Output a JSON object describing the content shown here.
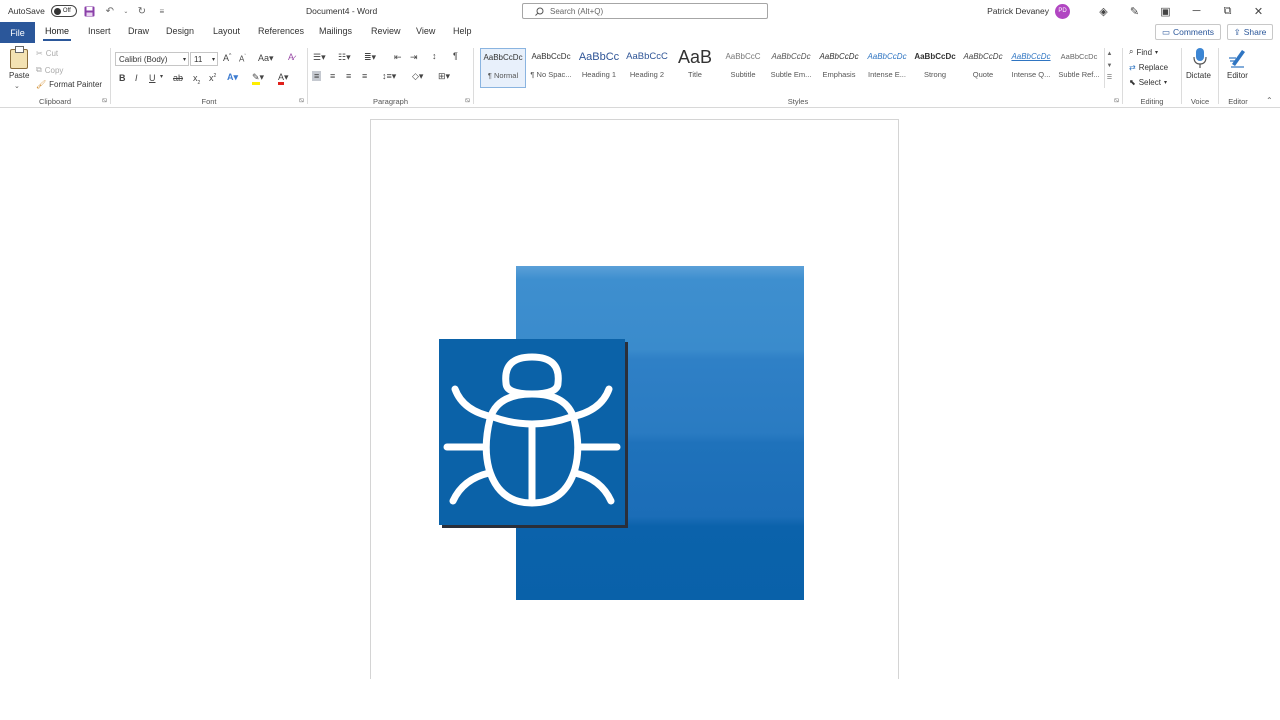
{
  "titlebar": {
    "autosave_label": "AutoSave",
    "autosave_state": "Off",
    "document_title": "Document4 - Word",
    "search_placeholder": "Search (Alt+Q)",
    "user_name": "Patrick Devaney",
    "user_initials": "PD"
  },
  "tabs": [
    "File",
    "Home",
    "Insert",
    "Draw",
    "Design",
    "Layout",
    "References",
    "Mailings",
    "Review",
    "View",
    "Help"
  ],
  "active_tab": "Home",
  "actions": {
    "comments_label": "Comments",
    "share_label": "Share"
  },
  "ribbon": {
    "clipboard": {
      "paste": "Paste",
      "cut": "Cut",
      "copy": "Copy",
      "format_painter": "Format Painter",
      "label": "Clipboard"
    },
    "font": {
      "font_name": "Calibri (Body)",
      "font_size": "11",
      "label": "Font"
    },
    "paragraph": {
      "label": "Paragraph"
    },
    "styles": {
      "label": "Styles",
      "items": [
        {
          "sample": "AaBbCcDc",
          "name": "¶ Normal"
        },
        {
          "sample": "AaBbCcDc",
          "name": "¶ No Spac..."
        },
        {
          "sample": "AaBbCc",
          "name": "Heading 1"
        },
        {
          "sample": "AaBbCcC",
          "name": "Heading 2"
        },
        {
          "sample": "AaB",
          "name": "Title"
        },
        {
          "sample": "AaBbCcC",
          "name": "Subtitle"
        },
        {
          "sample": "AaBbCcDc",
          "name": "Subtle Em..."
        },
        {
          "sample": "AaBbCcDc",
          "name": "Emphasis"
        },
        {
          "sample": "AaBbCcDc",
          "name": "Intense E..."
        },
        {
          "sample": "AaBbCcDc",
          "name": "Strong"
        },
        {
          "sample": "AaBbCcDc",
          "name": "Quote"
        },
        {
          "sample": "AaBbCcDc",
          "name": "Intense Q..."
        },
        {
          "sample": "AaBbCcDc",
          "name": "Subtle Ref..."
        }
      ]
    },
    "editing": {
      "find": "Find",
      "replace": "Replace",
      "select": "Select",
      "label": "Editing"
    },
    "voice": {
      "dictate": "Dictate",
      "label": "Voice"
    },
    "editor": {
      "editor": "Editor",
      "label": "Editor"
    }
  },
  "colors": {
    "file_tab": "#2b579a",
    "avatar": "#b146c2",
    "bug_tile": "#0b62a8",
    "blue_rect_top": "#5ba0d8",
    "blue_rect_bottom": "#0961a9"
  },
  "icons": {
    "bug": "bug-icon"
  }
}
